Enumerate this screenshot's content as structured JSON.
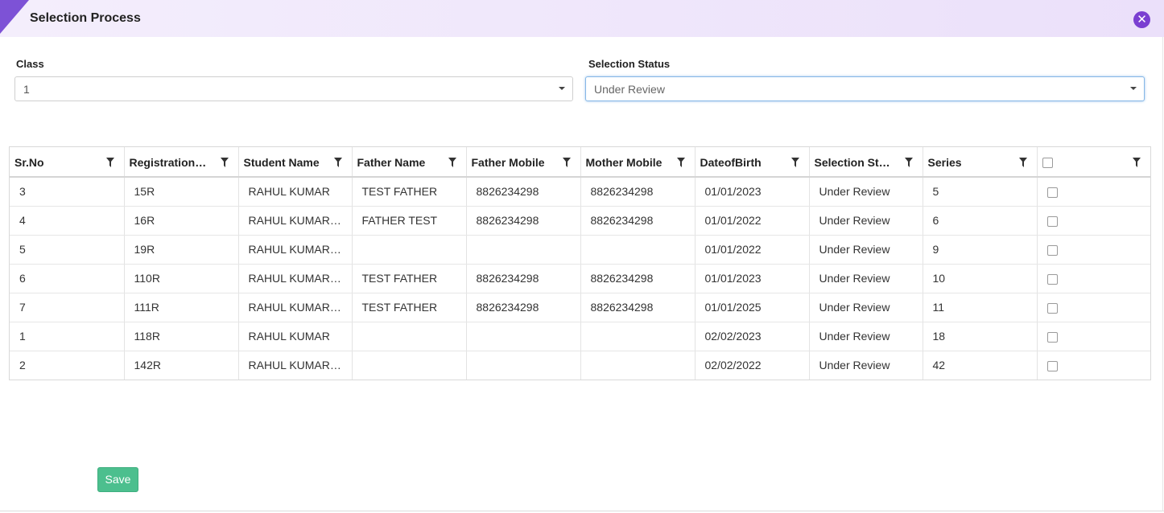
{
  "dialog": {
    "title": "Selection Process",
    "close_icon": "close-circle-icon"
  },
  "colors": {
    "accent": "#7a3fd1",
    "header_bg": "#ebe0fa",
    "save_button": "#4cbf8e"
  },
  "filters": {
    "class": {
      "label": "Class",
      "value": "1"
    },
    "selection_status": {
      "label": "Selection Status",
      "value": "Under Review"
    }
  },
  "grid": {
    "columns": [
      "Sr.No",
      "Registration No",
      "Student Name",
      "Father Name",
      "Father Mobile",
      "Mother Mobile",
      "DateofBirth",
      "Selection Status",
      "Series",
      ""
    ],
    "rows": [
      [
        "3",
        "15R",
        "RAHUL KUMAR",
        "TEST FATHER",
        "8826234298",
        "8826234298",
        "01/01/2023",
        "Under Review",
        "5"
      ],
      [
        "4",
        "16R",
        "RAHUL KUMAR KUMAR",
        "FATHER TEST",
        "8826234298",
        "8826234298",
        "01/01/2022",
        "Under Review",
        "6"
      ],
      [
        "5",
        "19R",
        "RAHUL KUMAR KUMAR",
        "",
        "",
        "",
        "01/01/2022",
        "Under Review",
        "9"
      ],
      [
        "6",
        "110R",
        "RAHUL KUMAR KUMAR",
        "TEST FATHER",
        "8826234298",
        "8826234298",
        "01/01/2023",
        "Under Review",
        "10"
      ],
      [
        "7",
        "111R",
        "RAHUL KUMAR KUMAR",
        "TEST FATHER",
        "8826234298",
        "8826234298",
        "01/01/2025",
        "Under Review",
        "11"
      ],
      [
        "1",
        "118R",
        "RAHUL KUMAR",
        "",
        "",
        "",
        "02/02/2023",
        "Under Review",
        "18"
      ],
      [
        "2",
        "142R",
        "RAHUL KUMAR KUMAR",
        "",
        "",
        "",
        "02/02/2022",
        "Under Review",
        "42"
      ]
    ]
  },
  "actions": {
    "save_label": "Save"
  }
}
